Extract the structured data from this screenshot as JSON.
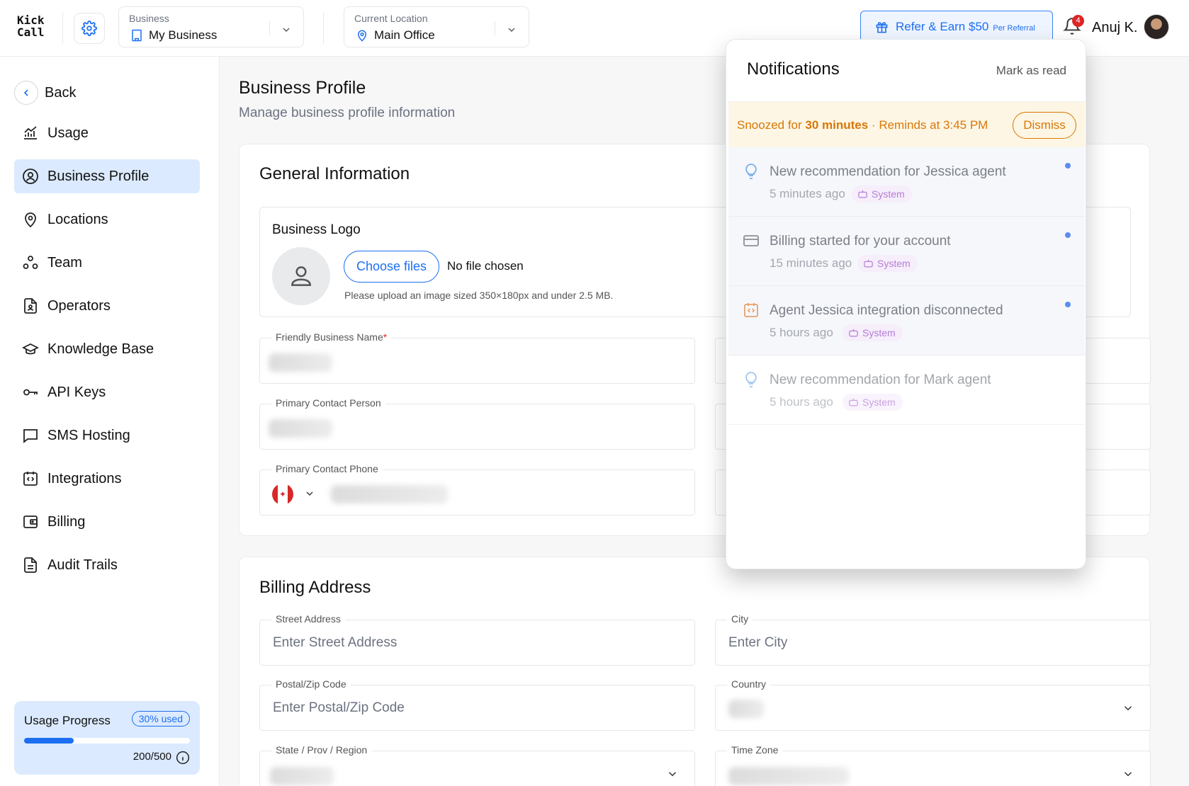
{
  "app": {
    "logo_line1": "Kick",
    "logo_line2": "Call"
  },
  "header": {
    "business_label": "Business",
    "business_value": "My Business",
    "location_label": "Current Location",
    "location_value": "Main Office",
    "refer_main": "Refer & Earn $50",
    "refer_sub": "Per Referral",
    "notification_count": "4",
    "user_name": "Anuj K."
  },
  "sidebar": {
    "back_label": "Back",
    "items": [
      {
        "label": "Usage",
        "icon": "chart-icon"
      },
      {
        "label": "Business Profile",
        "icon": "user-circle-icon",
        "active": true
      },
      {
        "label": "Locations",
        "icon": "map-pin-icon"
      },
      {
        "label": "Team",
        "icon": "team-icon"
      },
      {
        "label": "Operators",
        "icon": "file-user-icon"
      },
      {
        "label": "Knowledge Base",
        "icon": "graduation-cap-icon"
      },
      {
        "label": "API Keys",
        "icon": "key-icon"
      },
      {
        "label": "SMS Hosting",
        "icon": "message-icon"
      },
      {
        "label": "Integrations",
        "icon": "code-calendar-icon"
      },
      {
        "label": "Billing",
        "icon": "wallet-icon"
      },
      {
        "label": "Audit Trails",
        "icon": "document-icon"
      }
    ],
    "usage": {
      "title": "Usage Progress",
      "badge": "30% used",
      "fraction": 0.3,
      "count": "200/500"
    }
  },
  "page": {
    "title": "Business Profile",
    "subtitle": "Manage business profile information",
    "general": {
      "title": "General Information",
      "logo_title": "Business Logo",
      "choose_label": "Choose files",
      "no_file": "No file chosen",
      "upload_hint": "Please upload an image sized 350×180px and under 2.5 MB.",
      "fields": {
        "friendly_name": "Friendly Business Name",
        "required_mark": "*",
        "contact_person": "Primary Contact Person",
        "contact_phone": "Primary Contact Phone"
      }
    },
    "billing": {
      "title": "Billing Address",
      "street_label": "Street Address",
      "street_placeholder": "Enter Street Address",
      "city_label": "City",
      "city_placeholder": "Enter City",
      "postal_label": "Postal/Zip Code",
      "postal_placeholder": "Enter Postal/Zip Code",
      "country_label": "Country",
      "state_label": "State / Prov / Region",
      "timezone_label": "Time Zone"
    }
  },
  "notifications": {
    "title": "Notifications",
    "mark_read": "Mark as read",
    "snooze_prefix": "Snoozed for ",
    "snooze_duration": "30 minutes",
    "snooze_suffix": " · Reminds at 3:45 PM",
    "dismiss": "Dismiss",
    "items": [
      {
        "title": "New recommendation for Jessica agent",
        "time": "5 minutes ago",
        "tag": "System",
        "icon": "lightbulb-icon",
        "unread": true
      },
      {
        "title": "Billing started for your account",
        "time": "15 minutes ago",
        "tag": "System",
        "icon": "credit-card-icon",
        "unread": true
      },
      {
        "title": "Agent Jessica integration disconnected",
        "time": "5 hours ago",
        "tag": "System",
        "icon": "integration-icon",
        "unread": true
      },
      {
        "title": "New recommendation for Mark agent",
        "time": "5 hours ago",
        "tag": "System",
        "icon": "lightbulb-icon",
        "unread": false
      }
    ]
  },
  "colors": {
    "accent": "#1d6ff2",
    "active_bg": "#dbeafe",
    "snooze": "#d97706",
    "system_tag": "#b57dd6"
  }
}
